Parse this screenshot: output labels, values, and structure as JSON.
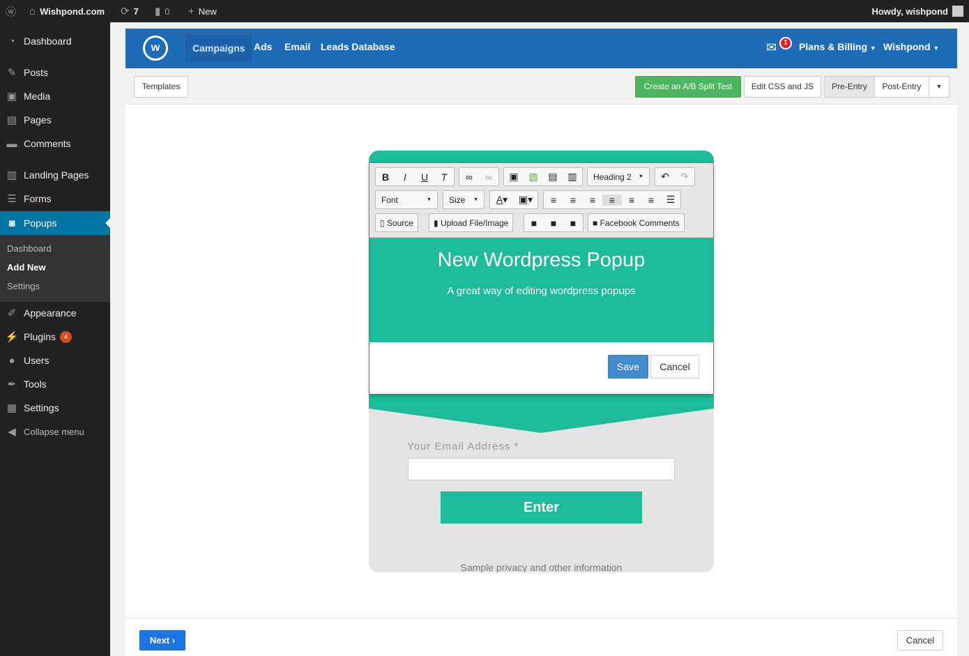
{
  "adminbar": {
    "site": "Wishpond.com",
    "updates": "7",
    "comments": "0",
    "new": "New",
    "howdy": "Howdy, wishpond"
  },
  "sidebar": {
    "items": [
      "Dashboard",
      "Posts",
      "Media",
      "Pages",
      "Comments",
      "Landing Pages",
      "Forms",
      "Popups",
      "Appearance",
      "Plugins",
      "Users",
      "Tools",
      "Settings",
      "Collapse menu"
    ],
    "plugins_badge": "4",
    "sub": [
      "Dashboard",
      "Add New",
      "Settings"
    ]
  },
  "topnav": {
    "logo": "w",
    "links": [
      "Campaigns",
      "Ads",
      "Email",
      "Leads Database"
    ],
    "notif": "1",
    "billing": "Plans & Billing",
    "account": "Wishpond"
  },
  "toolbar": {
    "templates": "Templates",
    "ab": "Create an A/B Split Test",
    "css": "Edit CSS and JS",
    "pre": "Pre-Entry",
    "post": "Post-Entry"
  },
  "editor": {
    "heading": "Heading 2",
    "font": "Font",
    "size": "Size",
    "source": "Source",
    "upload": "Upload File/Image",
    "fbcomments": "Facebook Comments",
    "title": "New Wordpress Popup",
    "subtitle": "A great way of editing wordpress popups",
    "save": "Save",
    "cancel": "Cancel"
  },
  "form": {
    "email_label": "Your Email Address *",
    "enter": "Enter",
    "privacy": "Sample privacy and other information"
  },
  "footer": {
    "next": "Next",
    "cancel": "Cancel"
  }
}
